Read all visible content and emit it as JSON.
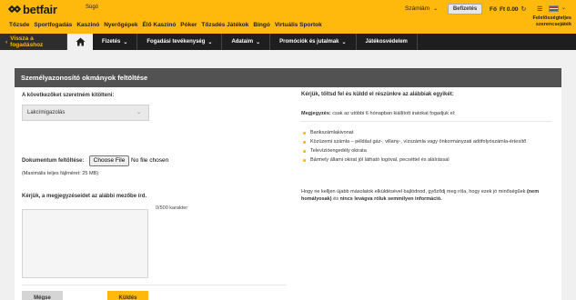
{
  "header": {
    "brand": "betfair",
    "help": "Súgó",
    "account": "Számlám",
    "logout": "Befizetés",
    "balance": "Ft 0.00",
    "balance_prefix": "Fő",
    "responsible_line1": "Felelősségteljes",
    "responsible_line2": "szerencsejáték",
    "nav": [
      "Tőzsde",
      "Sportfogadás",
      "Kaszinó",
      "Nyerőgépek",
      "Élő Kaszinó",
      "Póker",
      "Tőzsdés Játékok",
      "Bingó",
      "Virtuális Sportok"
    ],
    "flag_colors": [
      "#cd2a3e",
      "#ffffff",
      "#436f4d"
    ]
  },
  "subnav": {
    "back": "Vissza a fogadáshoz",
    "items": [
      "Fizetés",
      "Fogadási tevékenység",
      "Adataim",
      "Promóciók és jutalmak",
      "Játékosvédelem"
    ]
  },
  "panel": {
    "title": "Személyazonosító okmányok feltöltése",
    "select_label": "A következőket szeretném kitölteni:",
    "select_value": "Lakcímigazolás",
    "upload_label": "Dokumentum feltöltése:",
    "file_button": "Choose File",
    "file_status": "No file chosen",
    "max_size": "(Maximális teljes fájlméret: 25 MB)",
    "comment_label": "Kérjük, a megjegyzéseidet az alábbi mezőbe írd.",
    "counter": "0/500 karakter",
    "back_button": "Mégse",
    "send_button": "Küldés",
    "right_title": "Kérjük, töltsd fel és küldd el részünkre az alábbiak egyikét:",
    "note_label": "Megjegyzés:",
    "note_text": " csak az utóbbi 6 hónapban kiállított iratokat fogadjuk el:",
    "bullets": [
      "Bankszámlakivonat",
      "Közüzemi számla – például gáz-, villany-, vízszámla vagy önkormányzati adófolyószámla-értesítő",
      "Televízióengedély okirata",
      "Bármely állami okirat jól látható logóval, pecséttel és aláírással"
    ],
    "para_text": "Hogy ne kelljen újabb másolatok elküldésével bajlódnod, győződj meg róla, hogy ezek jó minőségűek ",
    "para_bold1": "(nem homályosak)",
    "para_mid": " és ",
    "para_bold2": "nincs levágva róluk semmilyen információ."
  }
}
